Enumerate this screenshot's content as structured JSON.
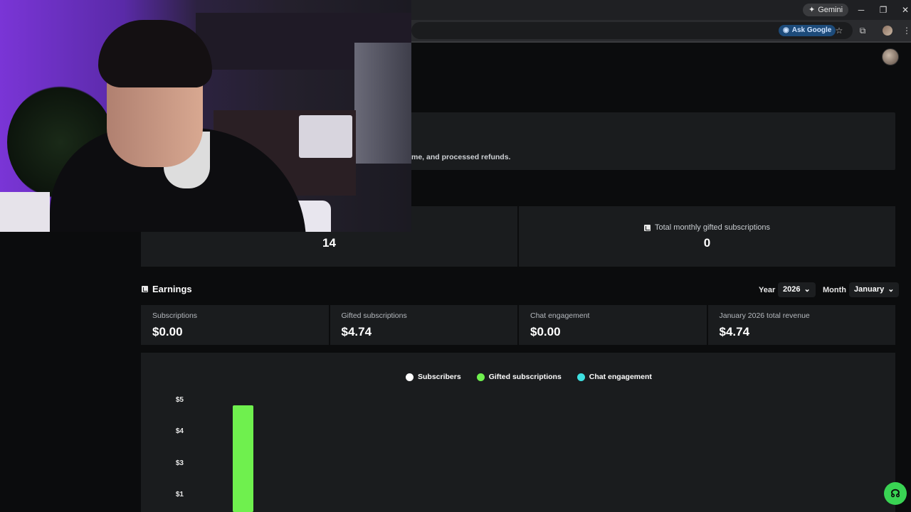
{
  "browser": {
    "gemini_label": "Gemini",
    "ask_google_label": "Ask Google",
    "window_controls": [
      "minimize-icon",
      "restore-icon",
      "close-icon"
    ]
  },
  "info": {
    "text": "me, and processed refunds."
  },
  "stats": [
    {
      "label": "",
      "value": "14"
    },
    {
      "label": "Total monthly gifted subscriptions",
      "value": "0"
    }
  ],
  "earnings": {
    "title": "Earnings",
    "year_label": "Year",
    "year_value": "2026",
    "month_label": "Month",
    "month_value": "January",
    "cards": [
      {
        "label": "Subscriptions",
        "value": "$0.00"
      },
      {
        "label": "Gifted subscriptions",
        "value": "$4.74"
      },
      {
        "label": "Chat engagement",
        "value": "$0.00"
      },
      {
        "label": "January 2026 total revenue",
        "value": "$4.74"
      }
    ]
  },
  "chart_data": {
    "type": "bar",
    "series": [
      {
        "name": "Subscribers",
        "color": "#ffffff",
        "values": [
          0
        ]
      },
      {
        "name": "Gifted subscriptions",
        "color": "#6ff04e",
        "values": [
          4.74
        ]
      },
      {
        "name": "Chat engagement",
        "color": "#3ee0e0",
        "values": [
          0
        ]
      }
    ],
    "y_ticks": [
      "$5",
      "$4",
      "$3",
      "$1"
    ],
    "y_tick_values": [
      5,
      4,
      3,
      1
    ],
    "ylim": [
      0,
      5
    ]
  },
  "colors": {
    "accent": "#39d353",
    "card_bg": "#1a1c1e",
    "page_bg": "#0b0c0d"
  }
}
